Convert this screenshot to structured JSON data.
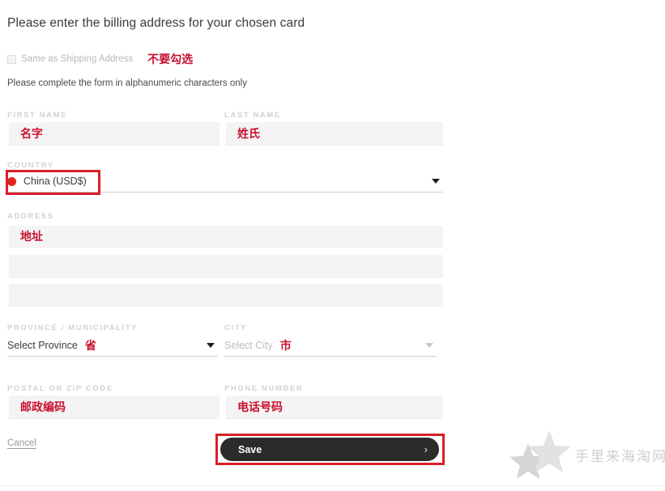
{
  "heading": "Please enter the billing address for your chosen card",
  "checkbox": {
    "label": "Same as Shipping Address",
    "checked": false,
    "annotation": "不要勾选"
  },
  "subnote": "Please complete the form in alphanumeric characters only",
  "fields": {
    "first_name": {
      "label": "FIRST NAME",
      "value": "名字",
      "placeholder": "名字"
    },
    "last_name": {
      "label": "LAST NAME",
      "value": "姓氏",
      "placeholder": "姓氏"
    },
    "country": {
      "label": "COUNTRY",
      "value": "China (USD$)",
      "flag": "country-flag-icon"
    },
    "address": {
      "label": "ADDRESS",
      "line1": {
        "value": "地址",
        "placeholder": "地址"
      },
      "line2": {
        "value": "",
        "placeholder": ""
      },
      "line3": {
        "value": "",
        "placeholder": ""
      }
    },
    "province": {
      "label": "PROVINCE / MUNICIPALITY",
      "value": "Select Province",
      "annotation": "省"
    },
    "city": {
      "label": "CITY",
      "value": "Select City",
      "annotation": "市"
    },
    "postal": {
      "label": "POSTAL OR ZIP CODE",
      "value": "邮政编码",
      "placeholder": "邮政编码"
    },
    "phone": {
      "label": "PHONE NUMBER",
      "value": "电话号码",
      "placeholder": "电话号码"
    }
  },
  "footer": {
    "cancel_label": "Cancel",
    "save_label": "Save",
    "save_chevron": "›"
  },
  "watermark": {
    "text": "手里来海淘网"
  },
  "colors": {
    "annotation_red": "#c8102e",
    "highlight_box": "#d81f28",
    "save_button": "#2b2b2b",
    "input_bg": "#f4f4f4",
    "label_gray": "#d2d2d2"
  }
}
